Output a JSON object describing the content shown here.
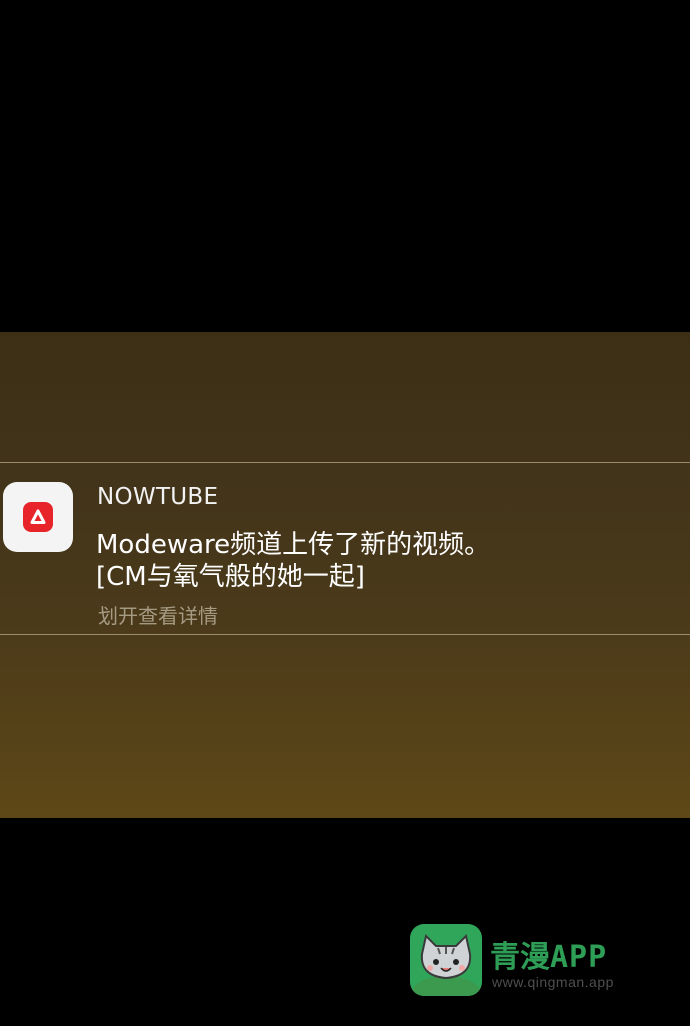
{
  "notification": {
    "app_name": "NOWTUBE",
    "message_line1": "Modeware频道上传了新的视频。",
    "message_line2": " [CM与氧气般的她一起]",
    "hint": "划开查看详情",
    "icon": "nowtube-logo-icon"
  },
  "watermark": {
    "title_cn": "青漫",
    "title_en": "APP",
    "url": "www.qingman.app",
    "icon": "cat-mascot-icon"
  },
  "colors": {
    "icon_red": "#e8242b",
    "watermark_green": "#2e9d56"
  }
}
